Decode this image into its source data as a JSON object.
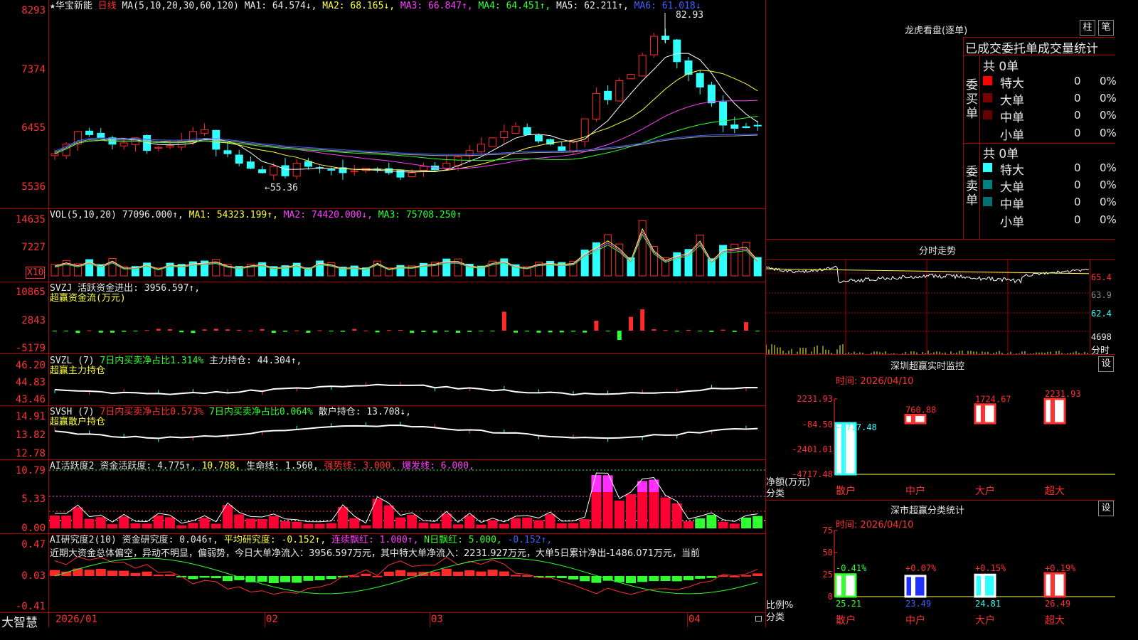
{
  "colors": {
    "up": "#ff2a2a",
    "down": "#30ffff",
    "grid": "#aa0000",
    "ma1": "#ffffff",
    "ma2": "#ffff40",
    "ma3": "#ff40ff",
    "ma4": "#30ff30",
    "ma5": "#aaaaaa",
    "ma6": "#4060ff"
  },
  "main": {
    "star_icon": "★",
    "stock_name": "华宝新能",
    "period": "日线",
    "ma_params": "MA(5,10,20,30,60,120)",
    "ma1": "MA1: 64.574↓,",
    "ma2": "MA2: 68.165↓,",
    "ma3": "MA3: 66.847↑,",
    "ma4": "MA4: 64.451↑,",
    "ma5": "MA5: 62.211↑,",
    "ma6": "MA6: 61.018↓",
    "high_label": "82.93",
    "low_label": "←55.36",
    "y_labels": [
      "8293",
      "7374",
      "6455",
      "5536"
    ]
  },
  "vol": {
    "params": "VOL(5,10,20)",
    "value": "77096.000↑,",
    "ma1": "MA1: 54323.199↑,",
    "ma2": "MA2: 74420.000↓,",
    "ma3": "MA3: 75708.250↑",
    "y_labels": [
      "14635",
      "7227"
    ],
    "unit": "X10"
  },
  "svzj": {
    "name": "SVZJ",
    "line1": "活跃资金进出: 3956.597↑,",
    "line2": "超赢资金流(万元)",
    "y_labels": [
      "10865",
      "2843",
      "-5179"
    ]
  },
  "svzl": {
    "name": "SVZL (7)",
    "a": "7日内买卖净占比1.314%",
    "b": "主力持仓: 44.304↑,",
    "line2": "超赢主力持仓",
    "y_labels": [
      "46.20",
      "44.83",
      "43.46"
    ]
  },
  "svsh": {
    "name": "SVSH (7)",
    "a": "7日内买卖净占比0.573%",
    "b": "7日内买卖净占比0.064%",
    "c": "散户持仓: 13.708↓,",
    "line2": "超赢散户持仓",
    "y_labels": [
      "14.91",
      "13.82",
      "12.78"
    ]
  },
  "ai1": {
    "name": "AI活跃度2",
    "a": "资金活跃度: 4.775↑,",
    "b": "10.788,",
    "c": "生命线: 1.560,",
    "d": "强势线: 3.000,",
    "e": "爆发线: 6.000,",
    "y_labels": [
      "10.79",
      "5.33",
      "0.00"
    ]
  },
  "ai2": {
    "name": "AI研究度2(10)",
    "a": "资金研究度: 0.046↑,",
    "b": "平均研究度: -0.152↑,",
    "c": "连续飘红: 1.000↑,",
    "d": "N日飘红: 5.000,",
    "e": "-0.152↑,",
    "comment": "近期大资金总体偏空，异动不明显，偏弱势，今日大单净流入：3956.597万元，其中特大单净流入：2231.927万元，大单5日累计净出-1486.071万元，当前",
    "y_labels": [
      "0.47",
      "0.03",
      "-0.41"
    ]
  },
  "dates": [
    "2026/01",
    "02",
    "03",
    "04"
  ],
  "bottom_logo": "大智慧",
  "right": {
    "lhb": {
      "title": "龙虎看盘(逐单)",
      "btn_bar": "柱",
      "btn_pen": "笔",
      "tabs": "已成交委托单成交量统计",
      "buy_side": "委买单",
      "sell_side": "委卖单",
      "buy_total": "共 0单",
      "sell_total": "共 0单",
      "buy_rows": [
        {
          "label": "特大",
          "count": "0",
          "pct": "0%"
        },
        {
          "label": "大单",
          "count": "0",
          "pct": "0%"
        },
        {
          "label": "中单",
          "count": "0",
          "pct": "0%"
        },
        {
          "label": "小单",
          "count": "0",
          "pct": "0%"
        }
      ],
      "sell_rows": [
        {
          "label": "特大",
          "count": "0",
          "pct": "0%"
        },
        {
          "label": "大单",
          "count": "0",
          "pct": "0%"
        },
        {
          "label": "中单",
          "count": "0",
          "pct": "0%"
        },
        {
          "label": "小单",
          "count": "0",
          "pct": "0%"
        }
      ]
    },
    "fenshi": {
      "title": "分时走势",
      "y_labels": [
        "65.4",
        "63.9",
        "62.4",
        "4698"
      ],
      "unit": "分时"
    },
    "sz_monitor": {
      "title": "深圳超赢实时监控",
      "btn": "设",
      "time": "时间: 2026/04/10",
      "y_labels": [
        "2231.93",
        "-84.50",
        "-2401.01",
        "-4717.48"
      ],
      "bar_values": [
        -4717.48,
        760.88,
        1724.67,
        2231.93
      ],
      "bar_labels": [
        "-4717.48",
        "760.88",
        "1724.67",
        "2231.93"
      ],
      "categories": [
        "散户",
        "中户",
        "大户",
        "超大"
      ],
      "ylabel": "净额(万元)",
      "xlabel": "分类"
    },
    "sz_class": {
      "title": "深市超赢分类统计",
      "btn": "设",
      "time": "时间: 2026/04/10",
      "y_labels": [
        "75",
        "50",
        "25",
        "0"
      ],
      "bar_values": [
        25.21,
        23.49,
        24.81,
        26.49
      ],
      "bar_values_text": [
        "25.21",
        "23.49",
        "24.81",
        "26.49"
      ],
      "change_labels": [
        "-0.41%",
        "+0.07%",
        "+0.15%",
        "+0.19%"
      ],
      "categories": [
        "散户",
        "中户",
        "大户",
        "超大"
      ],
      "ylabel": "比例%",
      "xlabel": "分类"
    }
  }
}
